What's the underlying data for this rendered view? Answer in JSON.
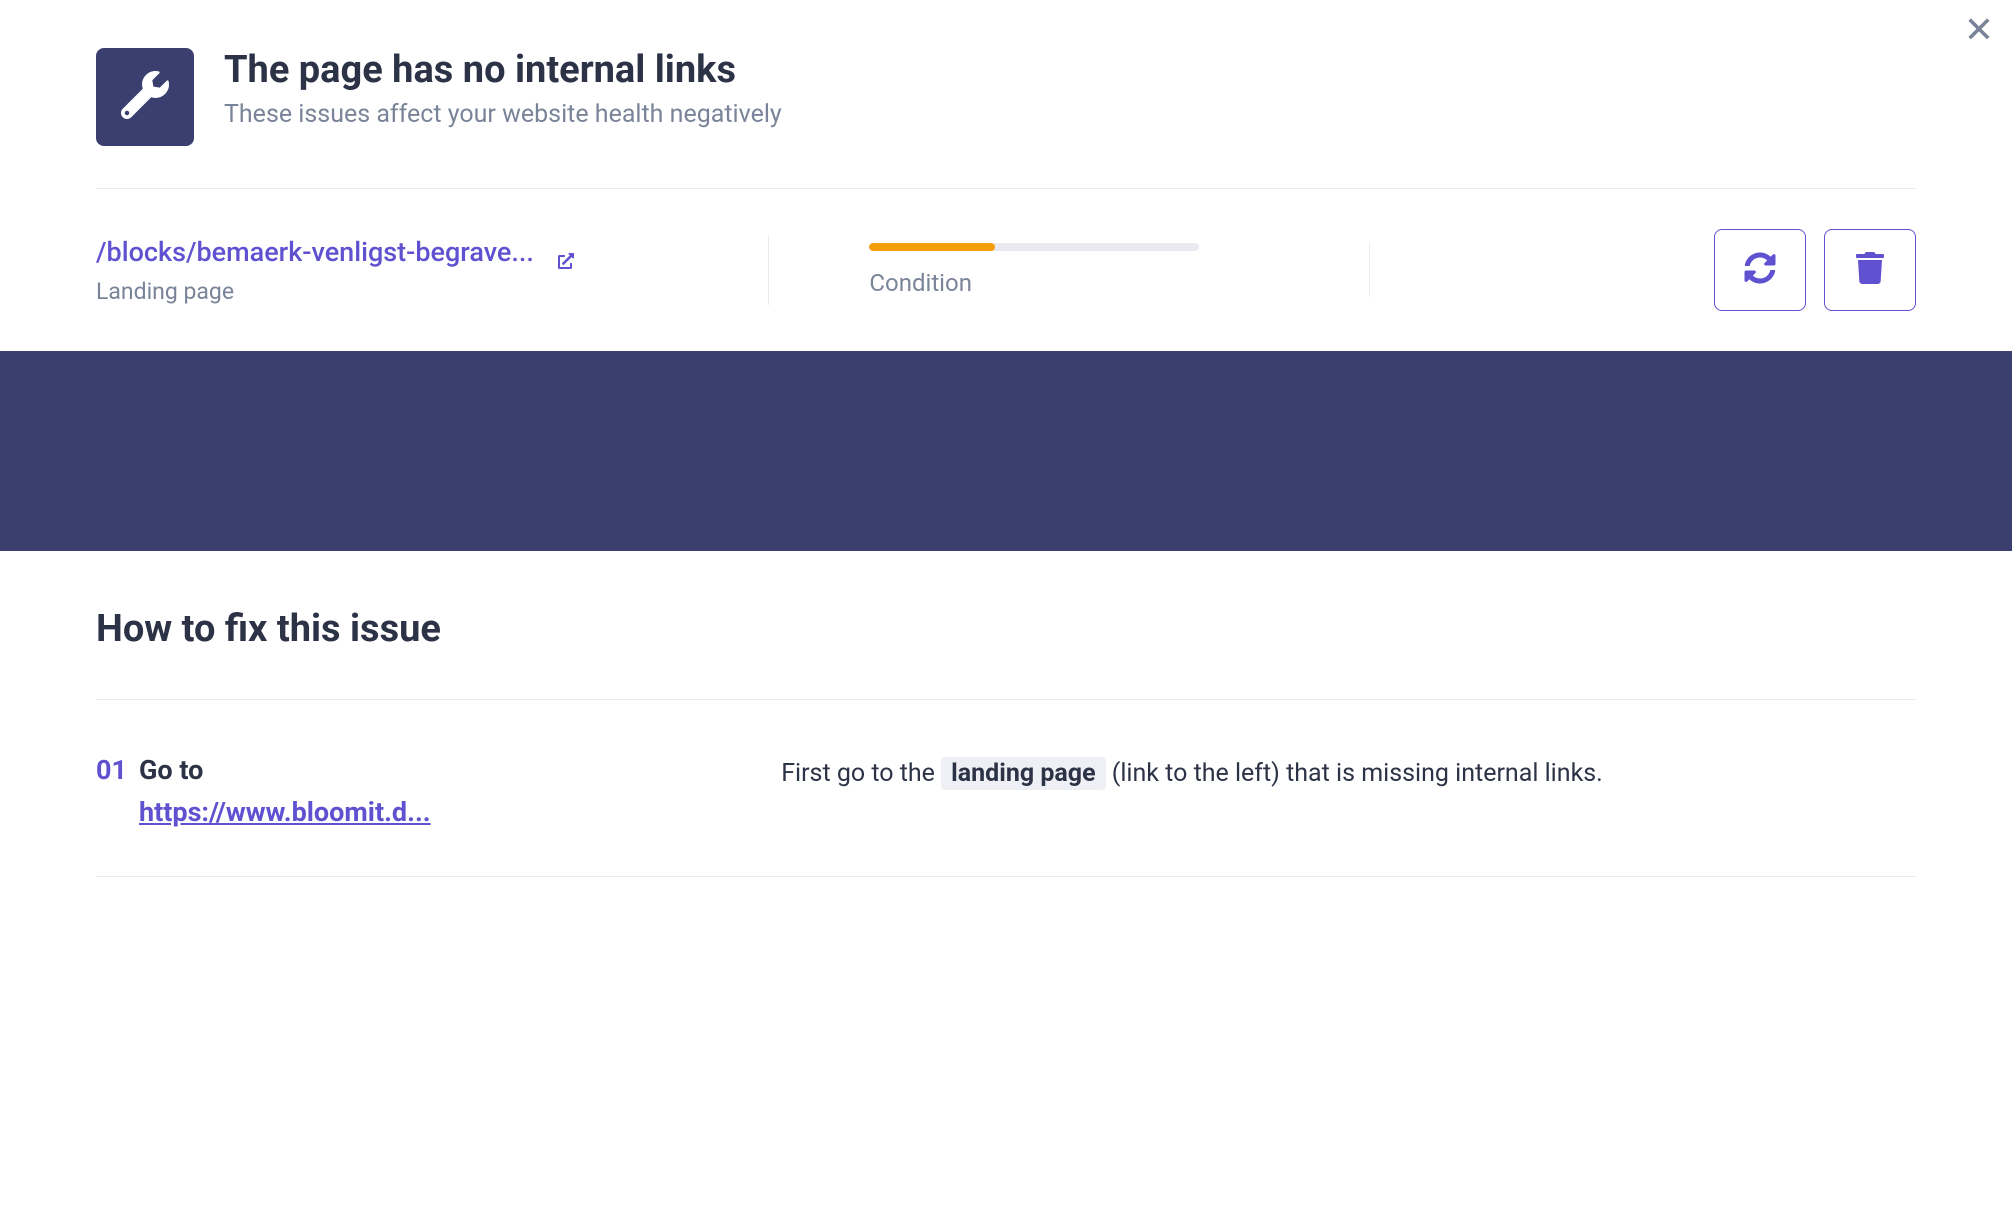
{
  "header": {
    "title": "The page has no internal links",
    "subtitle": "These issues affect your website health negatively"
  },
  "info": {
    "page_path": "/blocks/bemaerk-venligst-begrave...",
    "page_type": "Landing page",
    "condition_label": "Condition",
    "condition_percent": 38
  },
  "fix": {
    "heading": "How to fix this issue",
    "steps": [
      {
        "num": "01",
        "title": "Go to",
        "link": "https://www.bloomit.d...",
        "desc_pre": "First go to the ",
        "desc_highlight": "landing page",
        "desc_post": " (link to the left) that is missing internal links."
      }
    ]
  }
}
